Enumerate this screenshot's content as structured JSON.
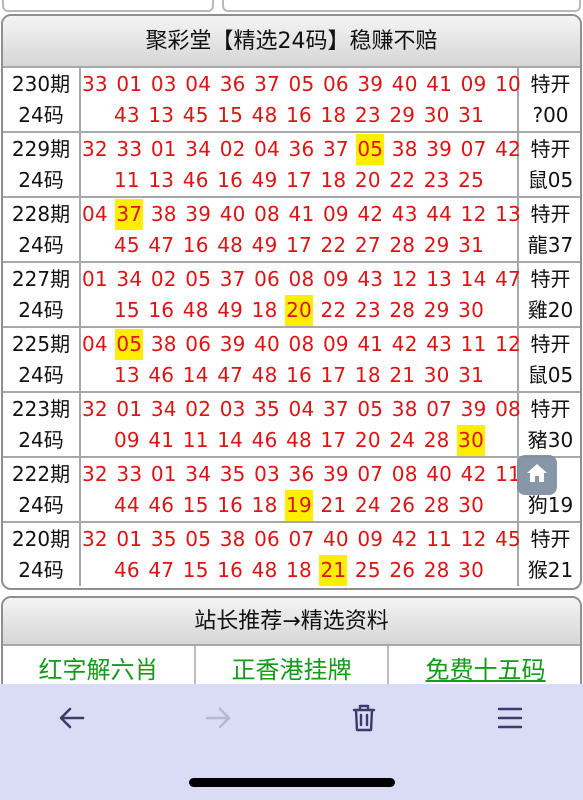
{
  "panel": {
    "title": "聚彩堂【精选24码】稳赚不赔",
    "rows": [
      {
        "issue": "230期",
        "count": "24码",
        "line1": [
          {
            "n": "33"
          },
          {
            "n": "01"
          },
          {
            "n": "03"
          },
          {
            "n": "04"
          },
          {
            "n": "36"
          },
          {
            "n": "37"
          },
          {
            "n": "05"
          },
          {
            "n": "06"
          },
          {
            "n": "39"
          },
          {
            "n": "40"
          },
          {
            "n": "41"
          },
          {
            "n": "09"
          },
          {
            "n": "10"
          }
        ],
        "line2": [
          {
            "n": "43"
          },
          {
            "n": "13"
          },
          {
            "n": "45"
          },
          {
            "n": "15"
          },
          {
            "n": "48"
          },
          {
            "n": "16"
          },
          {
            "n": "18"
          },
          {
            "n": "23"
          },
          {
            "n": "29"
          },
          {
            "n": "30"
          },
          {
            "n": "31"
          }
        ],
        "special_label": "特开",
        "special_value": "?00"
      },
      {
        "issue": "229期",
        "count": "24码",
        "line1": [
          {
            "n": "32"
          },
          {
            "n": "33"
          },
          {
            "n": "01"
          },
          {
            "n": "34"
          },
          {
            "n": "02"
          },
          {
            "n": "04"
          },
          {
            "n": "36"
          },
          {
            "n": "37"
          },
          {
            "n": "05",
            "hit": true
          },
          {
            "n": "38"
          },
          {
            "n": "39"
          },
          {
            "n": "07"
          },
          {
            "n": "42"
          }
        ],
        "line2": [
          {
            "n": "11"
          },
          {
            "n": "13"
          },
          {
            "n": "46"
          },
          {
            "n": "16"
          },
          {
            "n": "49"
          },
          {
            "n": "17"
          },
          {
            "n": "18"
          },
          {
            "n": "20"
          },
          {
            "n": "22"
          },
          {
            "n": "23"
          },
          {
            "n": "25"
          }
        ],
        "special_label": "特开",
        "special_value": "鼠05"
      },
      {
        "issue": "228期",
        "count": "24码",
        "line1": [
          {
            "n": "04"
          },
          {
            "n": "37",
            "hit": true
          },
          {
            "n": "38"
          },
          {
            "n": "39"
          },
          {
            "n": "40"
          },
          {
            "n": "08"
          },
          {
            "n": "41"
          },
          {
            "n": "09"
          },
          {
            "n": "42"
          },
          {
            "n": "43"
          },
          {
            "n": "44"
          },
          {
            "n": "12"
          },
          {
            "n": "13"
          }
        ],
        "line2": [
          {
            "n": "45"
          },
          {
            "n": "47"
          },
          {
            "n": "16"
          },
          {
            "n": "48"
          },
          {
            "n": "49"
          },
          {
            "n": "17"
          },
          {
            "n": "22"
          },
          {
            "n": "27"
          },
          {
            "n": "28"
          },
          {
            "n": "29"
          },
          {
            "n": "31"
          }
        ],
        "special_label": "特开",
        "special_value": "龍37"
      },
      {
        "issue": "227期",
        "count": "24码",
        "line1": [
          {
            "n": "01"
          },
          {
            "n": "34"
          },
          {
            "n": "02"
          },
          {
            "n": "05"
          },
          {
            "n": "37"
          },
          {
            "n": "06"
          },
          {
            "n": "08"
          },
          {
            "n": "09"
          },
          {
            "n": "43"
          },
          {
            "n": "12"
          },
          {
            "n": "13"
          },
          {
            "n": "14"
          },
          {
            "n": "47"
          }
        ],
        "line2": [
          {
            "n": "15"
          },
          {
            "n": "16"
          },
          {
            "n": "48"
          },
          {
            "n": "49"
          },
          {
            "n": "18"
          },
          {
            "n": "20",
            "hit": true
          },
          {
            "n": "22"
          },
          {
            "n": "23"
          },
          {
            "n": "28"
          },
          {
            "n": "29"
          },
          {
            "n": "30"
          }
        ],
        "special_label": "特开",
        "special_value": "雞20"
      },
      {
        "issue": "225期",
        "count": "24码",
        "line1": [
          {
            "n": "04"
          },
          {
            "n": "05",
            "hit": true
          },
          {
            "n": "38"
          },
          {
            "n": "06"
          },
          {
            "n": "39"
          },
          {
            "n": "40"
          },
          {
            "n": "08"
          },
          {
            "n": "09"
          },
          {
            "n": "41"
          },
          {
            "n": "42"
          },
          {
            "n": "43"
          },
          {
            "n": "11"
          },
          {
            "n": "12"
          }
        ],
        "line2": [
          {
            "n": "13"
          },
          {
            "n": "46"
          },
          {
            "n": "14"
          },
          {
            "n": "47"
          },
          {
            "n": "48"
          },
          {
            "n": "16"
          },
          {
            "n": "17"
          },
          {
            "n": "18"
          },
          {
            "n": "21"
          },
          {
            "n": "30"
          },
          {
            "n": "31"
          }
        ],
        "special_label": "特开",
        "special_value": "鼠05"
      },
      {
        "issue": "223期",
        "count": "24码",
        "line1": [
          {
            "n": "32"
          },
          {
            "n": "01"
          },
          {
            "n": "34"
          },
          {
            "n": "02"
          },
          {
            "n": "03"
          },
          {
            "n": "35"
          },
          {
            "n": "04"
          },
          {
            "n": "37"
          },
          {
            "n": "05"
          },
          {
            "n": "38"
          },
          {
            "n": "07"
          },
          {
            "n": "39"
          },
          {
            "n": "08"
          }
        ],
        "line2": [
          {
            "n": "09"
          },
          {
            "n": "41"
          },
          {
            "n": "11"
          },
          {
            "n": "14"
          },
          {
            "n": "46"
          },
          {
            "n": "48"
          },
          {
            "n": "17"
          },
          {
            "n": "20"
          },
          {
            "n": "24"
          },
          {
            "n": "28"
          },
          {
            "n": "30",
            "hit": true
          }
        ],
        "special_label": "特开",
        "special_value": "豬30"
      },
      {
        "issue": "222期",
        "count": "24码",
        "line1": [
          {
            "n": "32"
          },
          {
            "n": "33"
          },
          {
            "n": "01"
          },
          {
            "n": "34"
          },
          {
            "n": "35"
          },
          {
            "n": "03"
          },
          {
            "n": "36"
          },
          {
            "n": "39"
          },
          {
            "n": "07"
          },
          {
            "n": "08"
          },
          {
            "n": "40"
          },
          {
            "n": "42"
          },
          {
            "n": "11"
          }
        ],
        "line2": [
          {
            "n": "44"
          },
          {
            "n": "46"
          },
          {
            "n": "15"
          },
          {
            "n": "16"
          },
          {
            "n": "18"
          },
          {
            "n": "19",
            "hit": true
          },
          {
            "n": "21"
          },
          {
            "n": "24"
          },
          {
            "n": "26"
          },
          {
            "n": "28"
          },
          {
            "n": "30"
          }
        ],
        "special_label": "",
        "special_value": "狗19"
      },
      {
        "issue": "220期",
        "count": "24码",
        "line1": [
          {
            "n": "32"
          },
          {
            "n": "01"
          },
          {
            "n": "35"
          },
          {
            "n": "05"
          },
          {
            "n": "38"
          },
          {
            "n": "06"
          },
          {
            "n": "07"
          },
          {
            "n": "40"
          },
          {
            "n": "09"
          },
          {
            "n": "42"
          },
          {
            "n": "11"
          },
          {
            "n": "12"
          },
          {
            "n": "45"
          }
        ],
        "line2": [
          {
            "n": "46"
          },
          {
            "n": "47"
          },
          {
            "n": "15"
          },
          {
            "n": "16"
          },
          {
            "n": "48"
          },
          {
            "n": "18"
          },
          {
            "n": "21",
            "hit": true
          },
          {
            "n": "25"
          },
          {
            "n": "26"
          },
          {
            "n": "28"
          },
          {
            "n": "30"
          }
        ],
        "special_label": "特开",
        "special_value": "猴21"
      }
    ]
  },
  "recommend": {
    "title": "站长推荐→精选资料",
    "links": [
      "红字解六肖",
      "正香港挂牌",
      "免费十五码"
    ]
  },
  "colors": {
    "number_red": "#dd1414",
    "highlight_yellow": "#ffee00",
    "link_green": "#159a1a",
    "browser_bar": "#dadbf5"
  },
  "browser": {
    "icons": [
      "back-arrow-icon",
      "forward-arrow-icon",
      "trash-icon",
      "menu-icon"
    ]
  }
}
